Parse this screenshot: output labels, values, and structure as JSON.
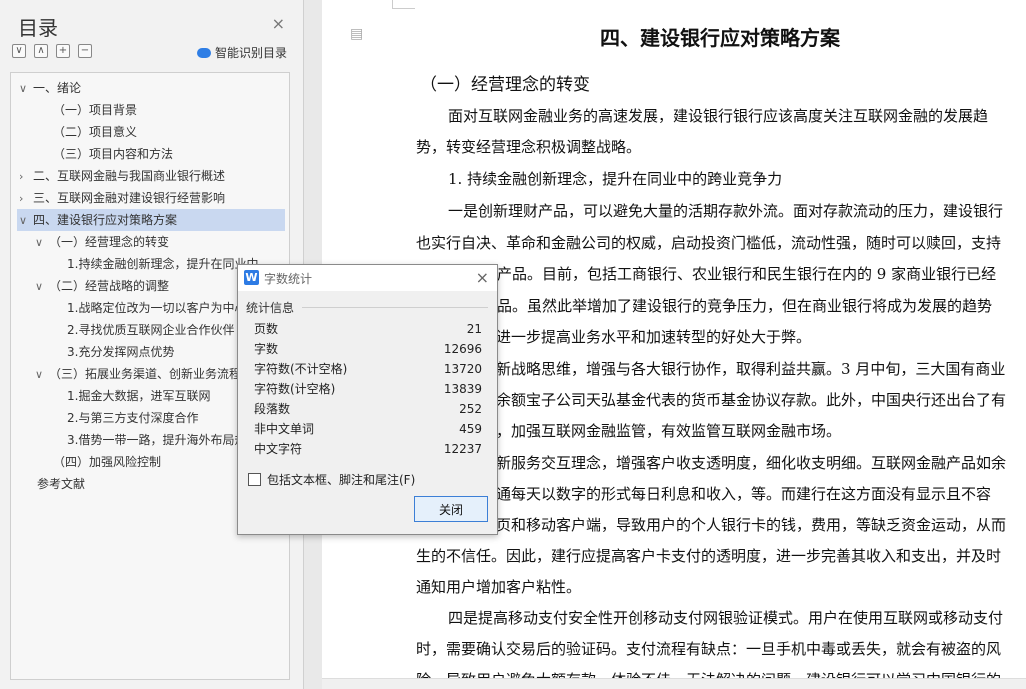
{
  "sidebar": {
    "title": "目录",
    "close_glyph": "×",
    "tools": [
      "∨",
      "∧",
      "+",
      "−"
    ],
    "smart_label": "智能识别目录",
    "items": [
      {
        "text": "一、绪论",
        "toggle": "∨"
      },
      {
        "text": "（一）项目背景",
        "toggle": ""
      },
      {
        "text": "（二）项目意义",
        "toggle": ""
      },
      {
        "text": "（三）项目内容和方法",
        "toggle": ""
      },
      {
        "text": "二、互联网金融与我国商业银行概述",
        "toggle": "›"
      },
      {
        "text": "三、互联网金融对建设银行经营影响",
        "toggle": "›"
      },
      {
        "text": "四、建设银行应对策略方案",
        "toggle": "∨"
      },
      {
        "text": "（一）经营理念的转变",
        "toggle": "∨"
      },
      {
        "text": "1.持续金融创新理念，提升在同业中",
        "toggle": ""
      },
      {
        "text": "（二）经营战略的调整",
        "toggle": "∨"
      },
      {
        "text": "1.战略定位改为一切以客户为中心",
        "toggle": ""
      },
      {
        "text": "2.寻找优质互联网企业合作伙伴",
        "toggle": ""
      },
      {
        "text": "3.充分发挥网点优势",
        "toggle": ""
      },
      {
        "text": "（三）拓展业务渠道、创新业务流程",
        "toggle": "∨"
      },
      {
        "text": "1.掘金大数据，进军互联网",
        "toggle": ""
      },
      {
        "text": "2.与第三方支付深度合作",
        "toggle": ""
      },
      {
        "text": "3.借势一带一路，提升海外布局规",
        "toggle": ""
      },
      {
        "text": "（四）加强风险控制",
        "toggle": ""
      },
      {
        "text": "参考文献",
        "toggle": ""
      }
    ]
  },
  "document": {
    "heading": "四、建设银行应对策略方案",
    "subheading": "（一）经营理念的转变",
    "lines": [
      "面对互联网金融业务的高速发展，建设银行银行应该高度关注互联网金融的发展趋",
      "势，转变经营理念积极调整战略。",
      "1. 持续金融创新理念，提升在同业中的跨业竞争力",
      "一是创新理财产品，可以避免大量的活期存款外流。面对存款流动的压力，建设银行",
      "也实行自决、革命和金融公司的权威，启动投资门槛低，流动性强，随时可以赎回，支持",
      "衡产品。目前，包括工商银行、农业银行和民生银行在内的 9 家商业银行已经",
      "产品。虽然此举增加了建设银行的竞争压力，但在商业银行将成为发展的趋势",
      "进一步提高业务水平和加速转型的好处大于弊。",
      "新战略思维，增强与各大银行协作，取得利益共赢。3 月中旬，三大国有商业",
      "余额宝子公司天弘基金代表的货币基金协议存款。此外，中国央行还出台了有",
      "，加强互联网金融监管，有效监管互联网金融市场。",
      "新服务交互理念，增强客户收支透明度，细化收支明细。互联网金融产品如余",
      "通每天以数字的形式每日利息和收入，等。而建行在这方面没有显示且不容",
      "页和移动客户端，导致用户的个人银行卡的钱，费用，等缺乏资金运动，从而",
      "生的不信任。因此，建行应提高客户卡支付的透明度，进一步完善其收入和支出，并及时",
      "通知用户增加客户粘性。",
      "四是提高移动支付安全性开创移动支付网银验证模式。用户在使用互联网或移动支付",
      "时，需要确认交易后的验证码。支付流程有缺点：一旦手机中毒或丢失，就会有被盗的风",
      "险，导致用户避免大额存款，体验不佳，无法解决的问题。建设银行可以学习中国银行的"
    ]
  },
  "dialog": {
    "icon_letter": "W",
    "title": "字数统计",
    "close_glyph": "×",
    "group_label": "统计信息",
    "stats": [
      {
        "label": "页数",
        "value": "21"
      },
      {
        "label": "字数",
        "value": "12696"
      },
      {
        "label": "字符数(不计空格)",
        "value": "13720"
      },
      {
        "label": "字符数(计空格)",
        "value": "13839"
      },
      {
        "label": "段落数",
        "value": "252"
      },
      {
        "label": "非中文单词",
        "value": "459"
      },
      {
        "label": "中文字符",
        "value": "12237"
      }
    ],
    "checkbox_label": "包括文本框、脚注和尾注(F)",
    "close_button": "关闭"
  }
}
